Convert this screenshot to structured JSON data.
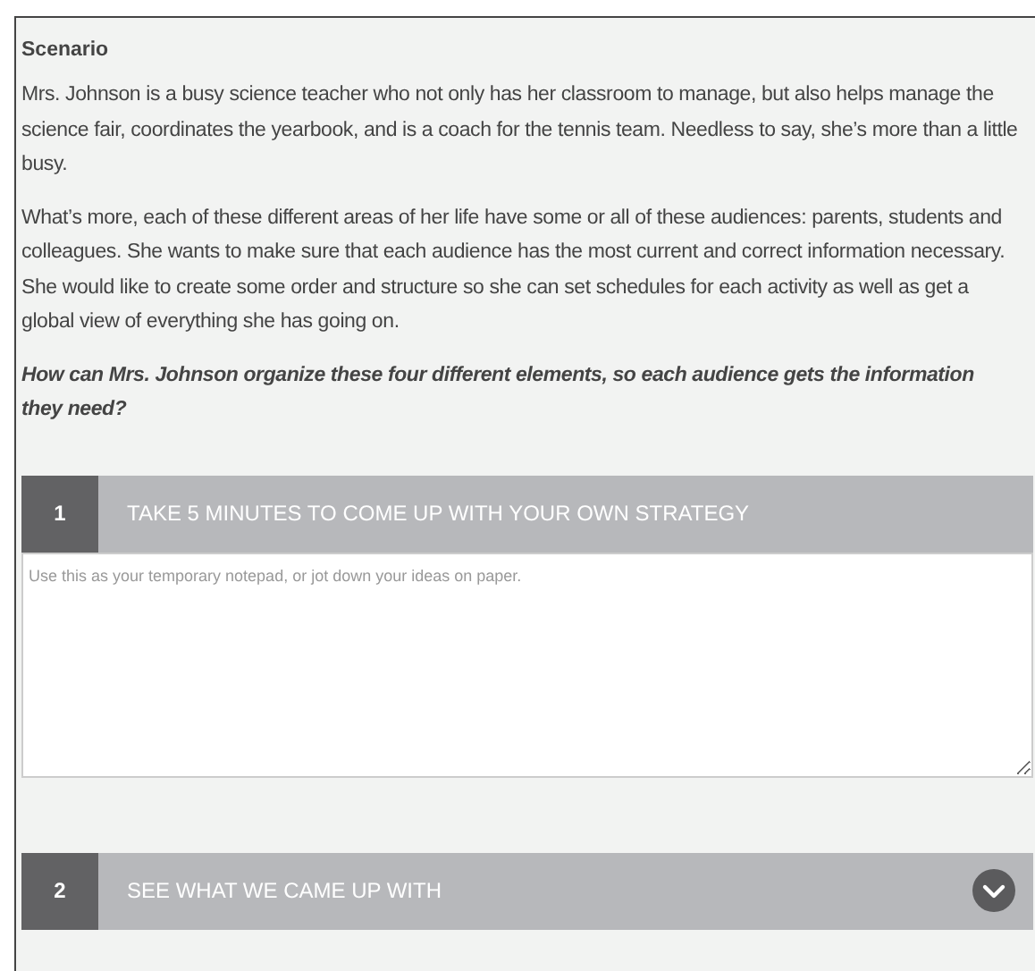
{
  "heading": "Scenario",
  "paragraphs": [
    "Mrs. Johnson is a busy science teacher who not only has her classroom to manage, but also helps manage the science fair, coordinates the yearbook, and is a coach for the tennis team. Needless to say, she’s more than a little busy.",
    "What’s more, each of these different areas of her life have some or all of these audiences: parents, students and colleagues. She wants to make sure that each audience has the most current and correct information necessary. She would like to create some order and structure so she can set schedules for each activity as well as get a global view of everything she has going on."
  ],
  "question": "How can Mrs. Johnson organize these four different elements, so each audience gets the information they need?",
  "steps": [
    {
      "number": "1",
      "title": "TAKE 5 MINUTES TO COME UP WITH YOUR OWN STRATEGY",
      "expanded": true,
      "placeholder": "Use this as your temporary notepad, or jot down your ideas on paper."
    },
    {
      "number": "2",
      "title": "SEE WHAT WE CAME UP WITH",
      "expanded": false
    }
  ]
}
